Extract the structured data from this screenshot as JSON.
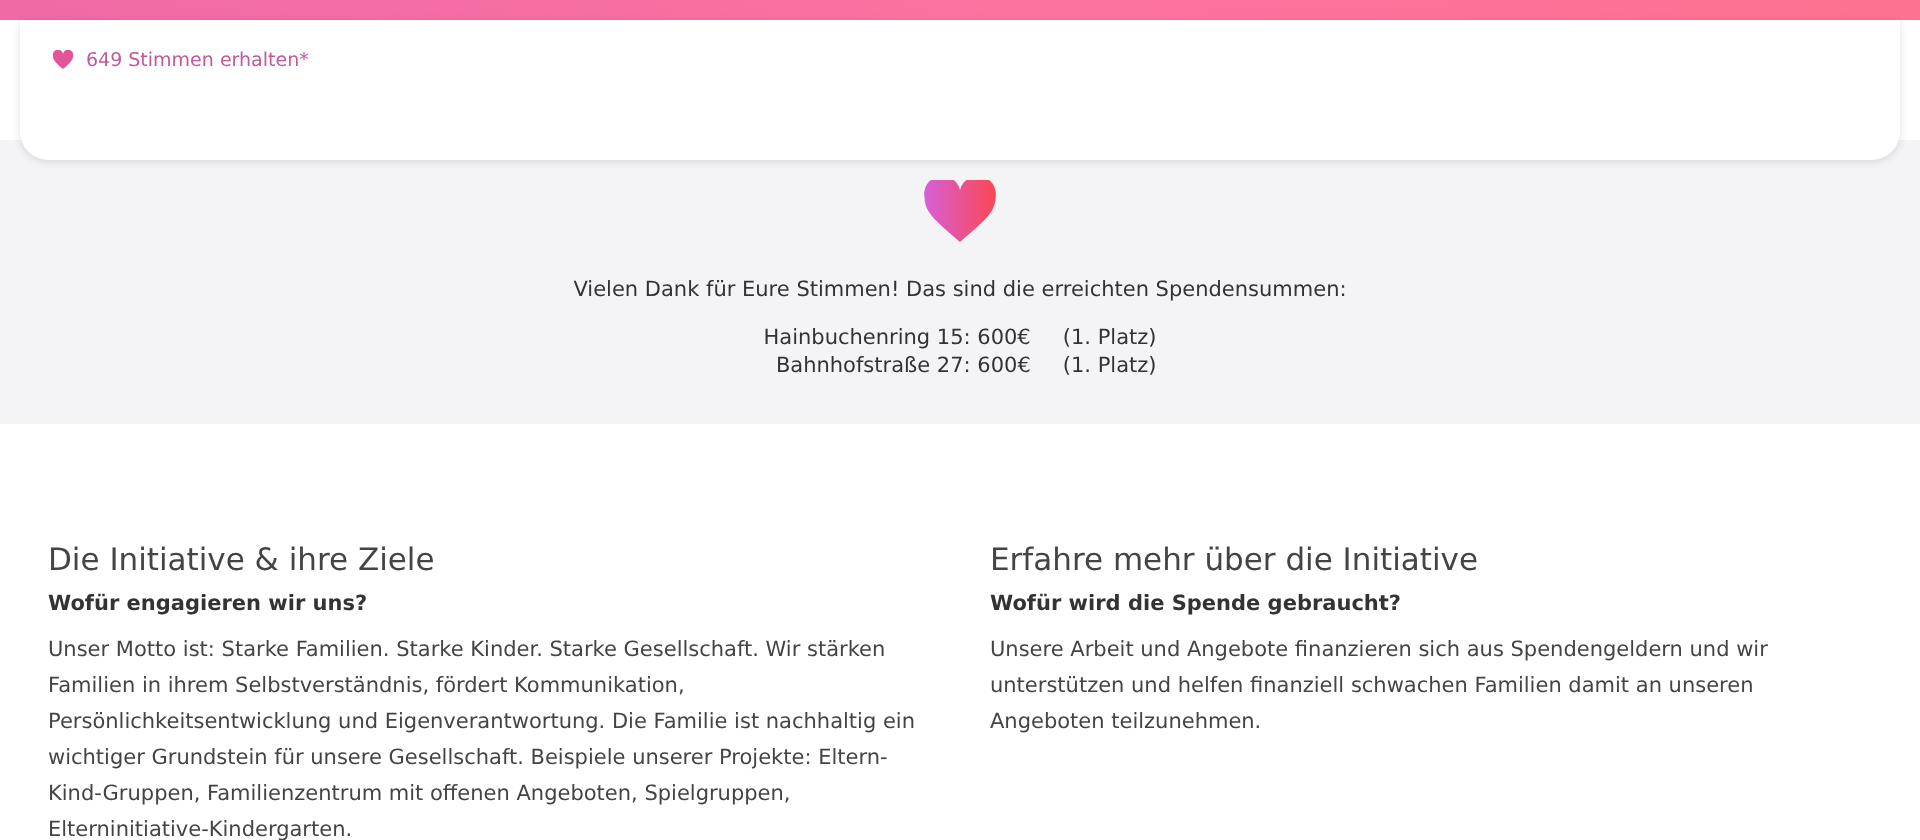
{
  "vote_card": {
    "votes": "649 Stimmen erhalten*"
  },
  "thanks": {
    "message": "Vielen Dank für Eure Stimmen! Das sind die erreichten Spendensummen:",
    "results": [
      {
        "name_amount": "Hainbuchenring 15: 600€",
        "rank": "(1. Platz)"
      },
      {
        "name_amount": "Bahnhofstraße 27: 600€",
        "rank": "(1. Platz)"
      }
    ]
  },
  "sections": [
    {
      "title": "Die Initiative & ihre Ziele",
      "subtitle": "Wofür engagieren wir uns?",
      "body": "Unser Motto ist: Starke Familien. Starke Kinder. Starke Gesellschaft. Wir stärken Familien in ihrem Selbstverständnis, fördert Kommunikation, Persönlichkeitsentwicklung und Eigenverantwortung. Die Familie ist nachhaltig ein wichtiger Grundstein für unsere Gesellschaft. Beispiele unserer Projekte: Eltern-Kind-Gruppen, Familienzentrum mit offenen Angeboten, Spielgruppen, Elterninitiative-Kindergarten."
    },
    {
      "title": "Erfahre mehr über die Initiative",
      "subtitle": "Wofür wird die Spende gebraucht?",
      "body": "Unsere Arbeit und Angebote finanzieren sich aus Spendengeldern und wir unterstützen und helfen finanziell schwachen Familien damit an unseren Angeboten teilzunehmen."
    }
  ]
}
